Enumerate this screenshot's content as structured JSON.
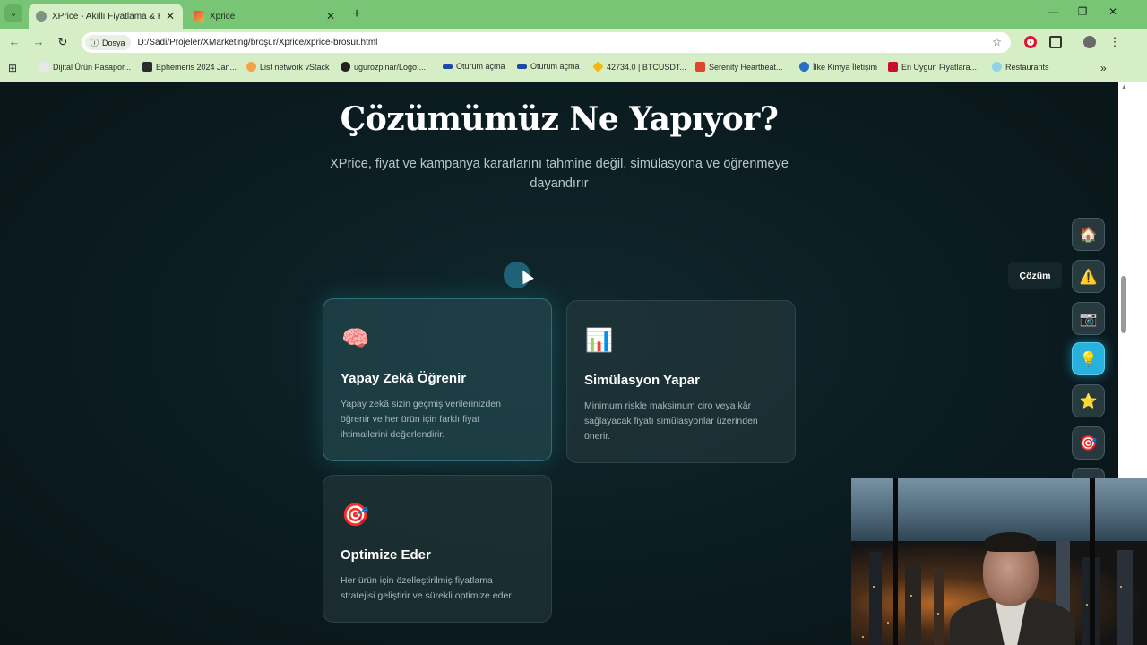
{
  "browser": {
    "tabs": [
      {
        "title": "XPrice - Akıllı Fiyatlama & Kamp",
        "active": true
      },
      {
        "title": "Xprice",
        "active": false
      }
    ],
    "address": {
      "badge": "Dosya",
      "url": "D:/Sadi/Projeler/XMarketing/broşür/Xprice/xprice-brosur.html"
    },
    "bookmarks": [
      {
        "label": "Dijital Ürün Pasapor...",
        "color": "#e7e7e7"
      },
      {
        "label": "Ephemeris 2024 Jan...",
        "color": "#2b2b2b"
      },
      {
        "label": "List network vStack",
        "color": "#f4a24b"
      },
      {
        "label": "ugurozpinar/Logo:...",
        "color": "#222222"
      },
      {
        "label": "Oturum açma",
        "color": "#1d4aa8"
      },
      {
        "label": "Oturum açma",
        "color": "#1d4aa8"
      },
      {
        "label": "42734.0 | BTCUSDT...",
        "color": "#f0b90b"
      },
      {
        "label": "Serenity Heartbeat...",
        "color": "#e0452a"
      },
      {
        "label": "İlke Kimya İletişim",
        "color": "#2b6cc4"
      },
      {
        "label": "En Uygun Fiyatlara...",
        "color": "#c8102e"
      },
      {
        "label": "Restaurants",
        "color": "#8fd3e8"
      }
    ],
    "more_bookmarks": "»"
  },
  "section": {
    "title": "Çözümümüz Ne Yapıyor?",
    "subtitle": "XPrice, fiyat ve kampanya kararlarını tahmine değil, simülasyona ve öğrenmeye dayandırır"
  },
  "cards": [
    {
      "icon": "brain-icon",
      "emoji": "🧠",
      "title": "Yapay Zekâ Öğrenir",
      "text": "Yapay zekâ sizin geçmiş verilerinizden öğrenir ve her ürün için farklı fiyat ihtimallerini değerlendirir."
    },
    {
      "icon": "bar-chart-icon",
      "emoji": "📊",
      "title": "Simülasyon Yapar",
      "text": "Minimum riskle maksimum ciro veya kâr sağlayacak fiyatı simülasyonlar üzerinden önerir."
    },
    {
      "icon": "target-icon",
      "emoji": "🎯",
      "title": "Optimize Eder",
      "text": "Her ürün için özelleştirilmiş fiyatlama stratejisi geliştirir ve sürekli optimize eder."
    }
  ],
  "sidenav": {
    "items": [
      {
        "name": "home-icon",
        "emoji": "🏠"
      },
      {
        "name": "warning-icon",
        "emoji": "⚠️"
      },
      {
        "name": "camera-icon",
        "emoji": "📷"
      },
      {
        "name": "lightbulb-icon",
        "emoji": "💡",
        "active": true
      },
      {
        "name": "star-icon",
        "emoji": "⭐"
      },
      {
        "name": "target-icon",
        "emoji": "🎯"
      }
    ],
    "tooltip": "Çözüm"
  },
  "colors": {
    "accent": "#27b1dc",
    "page_bg": "#0b1a1e",
    "chrome": "#79c576"
  }
}
